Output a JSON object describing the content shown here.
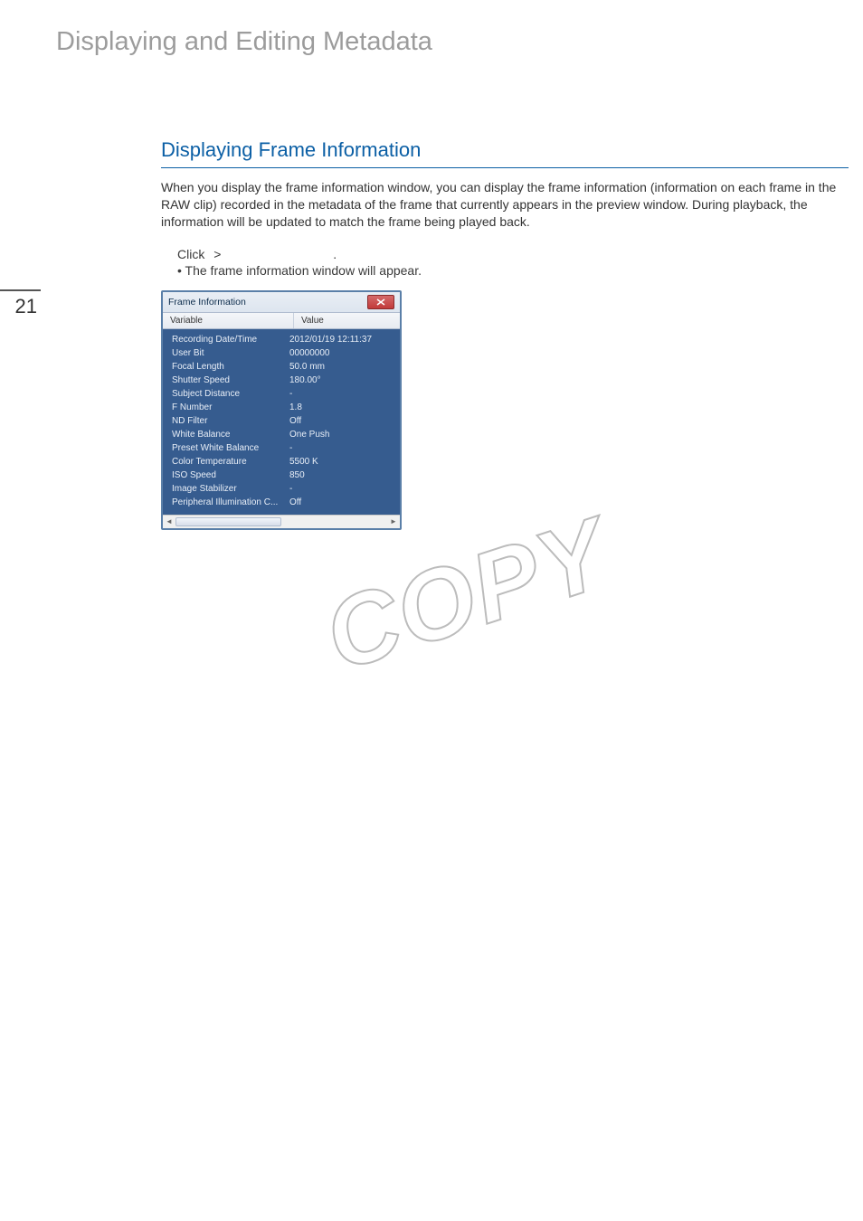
{
  "page_number": "21",
  "main_title": "Displaying and Editing Metadata",
  "section_heading": "Displaying Frame Information",
  "body_text": "When you display the frame information window, you can display the frame information (information on each frame in the RAW clip) recorded in the metadata of the frame that currently appears in the preview window. During playback, the information will be updated to match the frame being played back.",
  "instruction": {
    "click_label": "Click",
    "gt": ">",
    "period": "."
  },
  "bullet": "• The frame information window will appear.",
  "fi_window": {
    "title": "Frame Information",
    "headers": {
      "variable": "Variable",
      "value": "Value"
    },
    "rows": [
      {
        "var": "Recording Date/Time",
        "val": "2012/01/19 12:11:37"
      },
      {
        "var": "User Bit",
        "val": "00000000"
      },
      {
        "var": "Focal Length",
        "val": "50.0 mm"
      },
      {
        "var": "Shutter Speed",
        "val": "180.00°"
      },
      {
        "var": "Subject Distance",
        "val": "-"
      },
      {
        "var": "F Number",
        "val": "1.8"
      },
      {
        "var": "ND Filter",
        "val": "Off"
      },
      {
        "var": "White Balance",
        "val": "One Push"
      },
      {
        "var": "Preset White Balance",
        "val": "-"
      },
      {
        "var": "Color Temperature",
        "val": "5500 K"
      },
      {
        "var": "ISO Speed",
        "val": "850"
      },
      {
        "var": "Image Stabilizer",
        "val": "-"
      },
      {
        "var": "Peripheral Illumination C...",
        "val": "Off"
      }
    ]
  },
  "watermark": "COPY"
}
